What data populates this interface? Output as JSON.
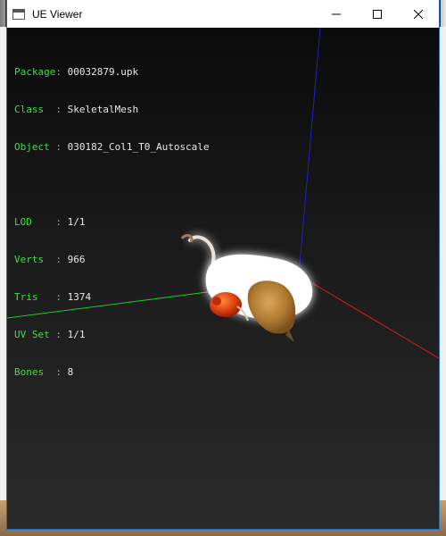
{
  "window": {
    "title": "UE Viewer",
    "minimize_glyph": "—",
    "maximize_glyph": "☐",
    "close_glyph": "✕"
  },
  "info": {
    "package_label": "Package:",
    "package_value": "00032879.upk",
    "class_label": "Class  :",
    "class_value": "SkeletalMesh",
    "object_label": "Object :",
    "object_value": "030182_Col1_T0_Autoscale",
    "lod_label": "LOD    :",
    "lod_value": "1/1",
    "verts_label": "Verts  :",
    "verts_value": "966",
    "tris_label": "Tris   :",
    "tris_value": "1374",
    "uvset_label": "UV Set :",
    "uvset_value": "1/1",
    "bones_label": "Bones  :",
    "bones_value": "8"
  },
  "axes": {
    "x_color": "#cc2020",
    "y_color": "#22cc22",
    "z_color": "#2020cc"
  },
  "model": {
    "body_color": "#ffffff",
    "fur_color": "#c8903a",
    "ball_color": "#e04010"
  }
}
